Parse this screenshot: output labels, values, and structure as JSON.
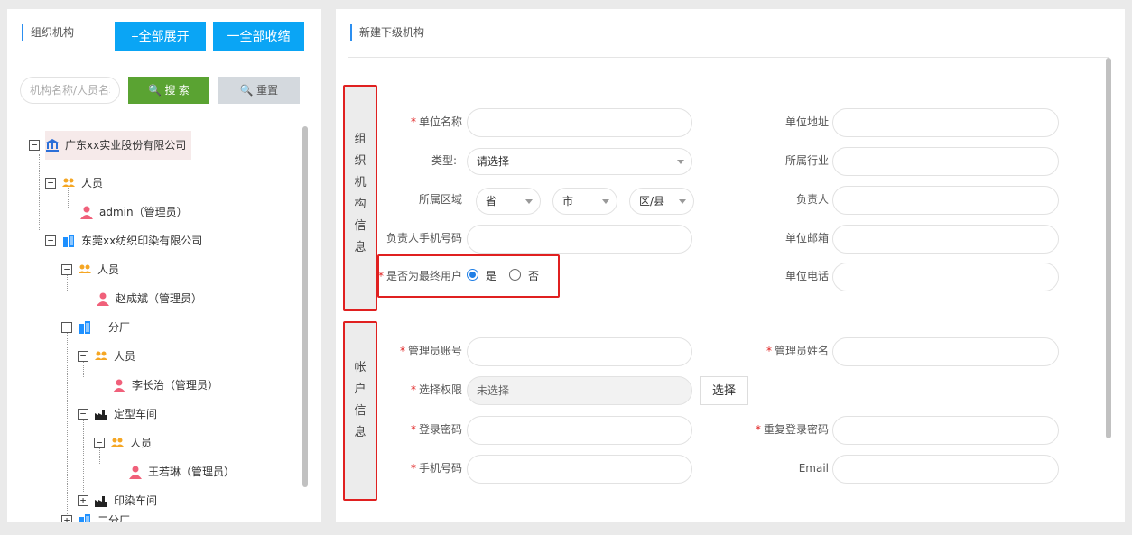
{
  "left": {
    "title": "组织机构",
    "expand_all": "+全部展开",
    "collapse_all": "一全部收缩",
    "search_placeholder": "机构名称/人员名称",
    "search_btn": "搜 索",
    "reset_btn": "重置",
    "tree": [
      {
        "label": "广东xx实业股份有限公司",
        "icon": "bank-icon",
        "toggle": "−"
      },
      {
        "label": "人员",
        "icon": "people-icon",
        "toggle": "−"
      },
      {
        "label": "admin（管理员）",
        "icon": "user-icon"
      },
      {
        "label": "东莞xx纺织印染有限公司",
        "icon": "building-icon",
        "toggle": "−"
      },
      {
        "label": "人员",
        "icon": "people-icon",
        "toggle": "−"
      },
      {
        "label": "赵成斌（管理员）",
        "icon": "user-icon"
      },
      {
        "label": "一分厂",
        "icon": "building-icon",
        "toggle": "−"
      },
      {
        "label": "人员",
        "icon": "people-icon",
        "toggle": "−"
      },
      {
        "label": "李长治（管理员）",
        "icon": "user-icon"
      },
      {
        "label": "定型车间",
        "icon": "factory-icon",
        "toggle": "−"
      },
      {
        "label": "人员",
        "icon": "people-icon",
        "toggle": "−"
      },
      {
        "label": "王若琳（管理员）",
        "icon": "user-icon"
      },
      {
        "label": "印染车间",
        "icon": "factory-icon",
        "toggle": "+"
      },
      {
        "label": "二分厂",
        "icon": "building-icon",
        "toggle": "+"
      }
    ]
  },
  "right": {
    "title": "新建下级机构",
    "section_org": [
      "组",
      "织",
      "机",
      "构",
      "信",
      "息"
    ],
    "section_account": [
      "帐",
      "户",
      "信",
      "息"
    ],
    "fields": {
      "unit_name": "单位名称",
      "unit_address": "单位地址",
      "type": "类型:",
      "type_value": "请选择",
      "industry": "所属行业",
      "region": "所属区域",
      "province": "省",
      "city": "市",
      "district": "区/县",
      "leader": "负责人",
      "leader_phone": "负责人手机号码",
      "unit_email": "单位邮箱",
      "is_final_user": "是否为最终用户",
      "yes": "是",
      "no": "否",
      "unit_phone": "单位电话",
      "admin_account": "管理员账号",
      "admin_name": "管理员姓名",
      "permissions": "选择权限",
      "permissions_value": "未选择",
      "select_btn": "选择",
      "login_password": "登录密码",
      "repeat_password": "重复登录密码",
      "mobile": "手机号码",
      "email": "Email"
    },
    "required_mark": "*"
  },
  "colors": {
    "accent_blue": "#0aa5f5",
    "search_green": "#5aa332",
    "highlight_red": "#e02020"
  }
}
